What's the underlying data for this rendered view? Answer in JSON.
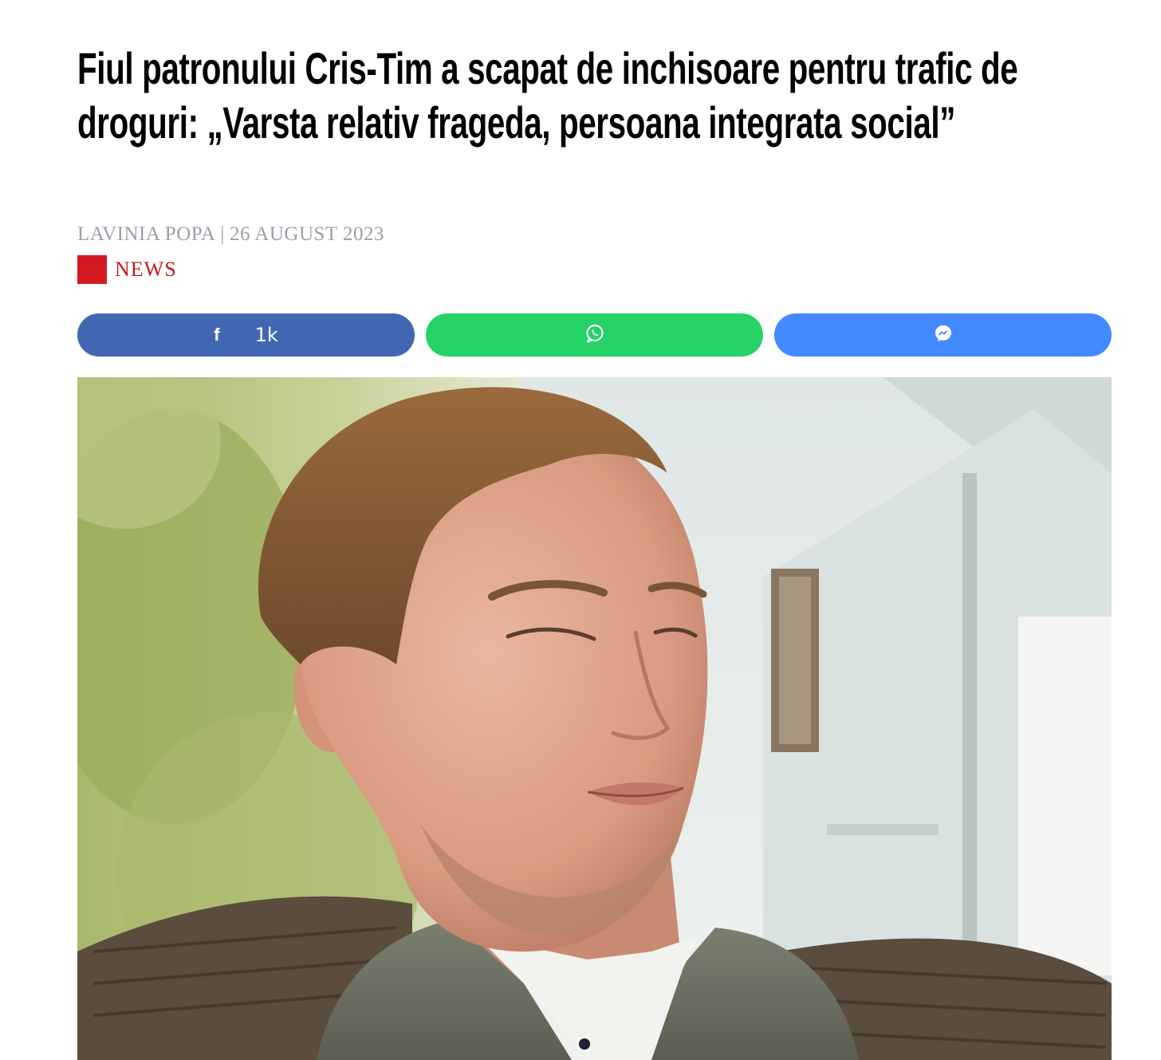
{
  "article": {
    "title": "Fiul patronului Cris-Tim a scapat de inchisoare pentru trafic de droguri: „Varsta relativ frageda, persoana integrata social”",
    "author": "LAVINIA POPA",
    "separator": "|",
    "date": "26 AUGUST 2023",
    "category": "NEWS",
    "category_color": "#d31a22"
  },
  "share": {
    "facebook": {
      "icon": "facebook-icon",
      "count": "1k",
      "color": "#4267b2"
    },
    "whatsapp": {
      "icon": "whatsapp-icon",
      "color": "#25d366"
    },
    "messenger": {
      "icon": "messenger-icon",
      "color": "#448aff"
    }
  },
  "hero_image": {
    "subject": "portrait-photo"
  }
}
